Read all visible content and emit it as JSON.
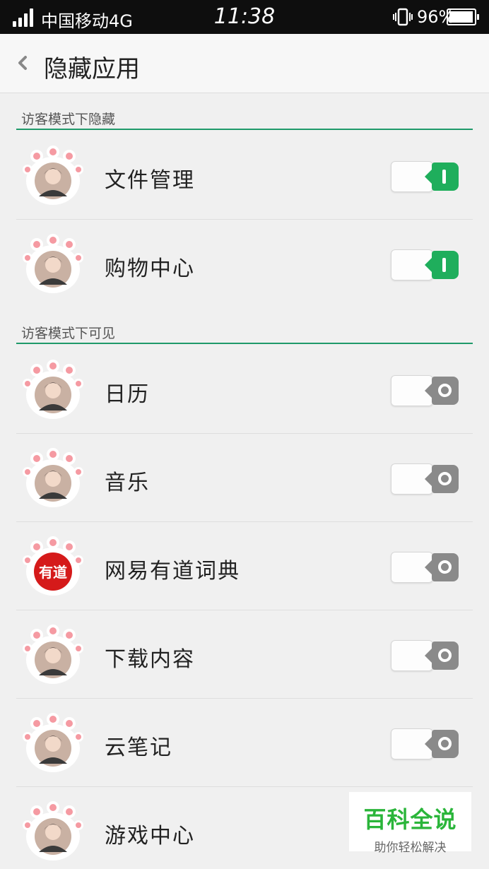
{
  "status_bar": {
    "carrier": "中国移动4G",
    "time": "11:38",
    "battery": "96%",
    "battery_level": 0.96
  },
  "header": {
    "title": "隐藏应用"
  },
  "sections": [
    {
      "label": "访客模式下隐藏"
    },
    {
      "label": "访客模式下可见"
    }
  ],
  "apps": [
    {
      "label": "文件管理",
      "enabled": true,
      "icon": "avatar-icon"
    },
    {
      "label": "购物中心",
      "enabled": true,
      "icon": "avatar-icon"
    },
    {
      "label": "日历",
      "enabled": false,
      "icon": "avatar-icon"
    },
    {
      "label": "音乐",
      "enabled": false,
      "icon": "avatar-icon"
    },
    {
      "label": "网易有道词典",
      "enabled": false,
      "icon": "youdao-logo-icon",
      "icon_text": "有道"
    },
    {
      "label": "下载内容",
      "enabled": false,
      "icon": "avatar-icon"
    },
    {
      "label": "云笔记",
      "enabled": false,
      "icon": "avatar-icon"
    },
    {
      "label": "游戏中心",
      "enabled": false,
      "icon": "avatar-icon"
    }
  ],
  "watermark": {
    "title": "百科全说",
    "subtitle": "助你轻松解决"
  },
  "colors": {
    "accent": "#1f9a6a",
    "toggle_on": "#1fae5c",
    "toggle_off": "#8a8a8a",
    "paw_pink": "#f59aa2"
  }
}
